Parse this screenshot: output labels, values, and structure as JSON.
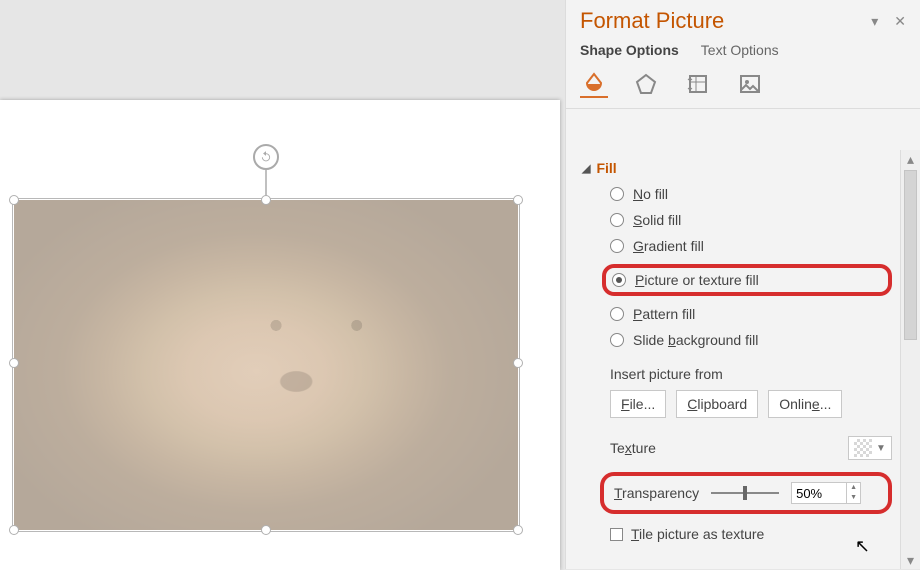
{
  "panel": {
    "title": "Format Picture",
    "tabs": {
      "shape": "Shape Options",
      "text": "Text Options"
    },
    "section": "Fill",
    "fill_options": {
      "none": "No fill",
      "solid": "Solid fill",
      "gradient": "Gradient fill",
      "picture": "Picture or texture fill",
      "pattern": "Pattern fill",
      "slidebg": "Slide background fill"
    },
    "insert_label": "Insert picture from",
    "buttons": {
      "file": "File...",
      "clipboard": "Clipboard",
      "online": "Online..."
    },
    "texture_label": "Texture",
    "transparency_label": "Transparency",
    "transparency_value": "50%",
    "tile_label": "Tile picture as texture"
  },
  "underline": {
    "no": "N",
    "solid": "S",
    "gradient": "G",
    "picture": "P",
    "pattern": "P",
    "bg": "b",
    "file": "F",
    "clip": "C",
    "online": "O",
    "tex": "x",
    "trans": "T",
    "tile": "T"
  }
}
